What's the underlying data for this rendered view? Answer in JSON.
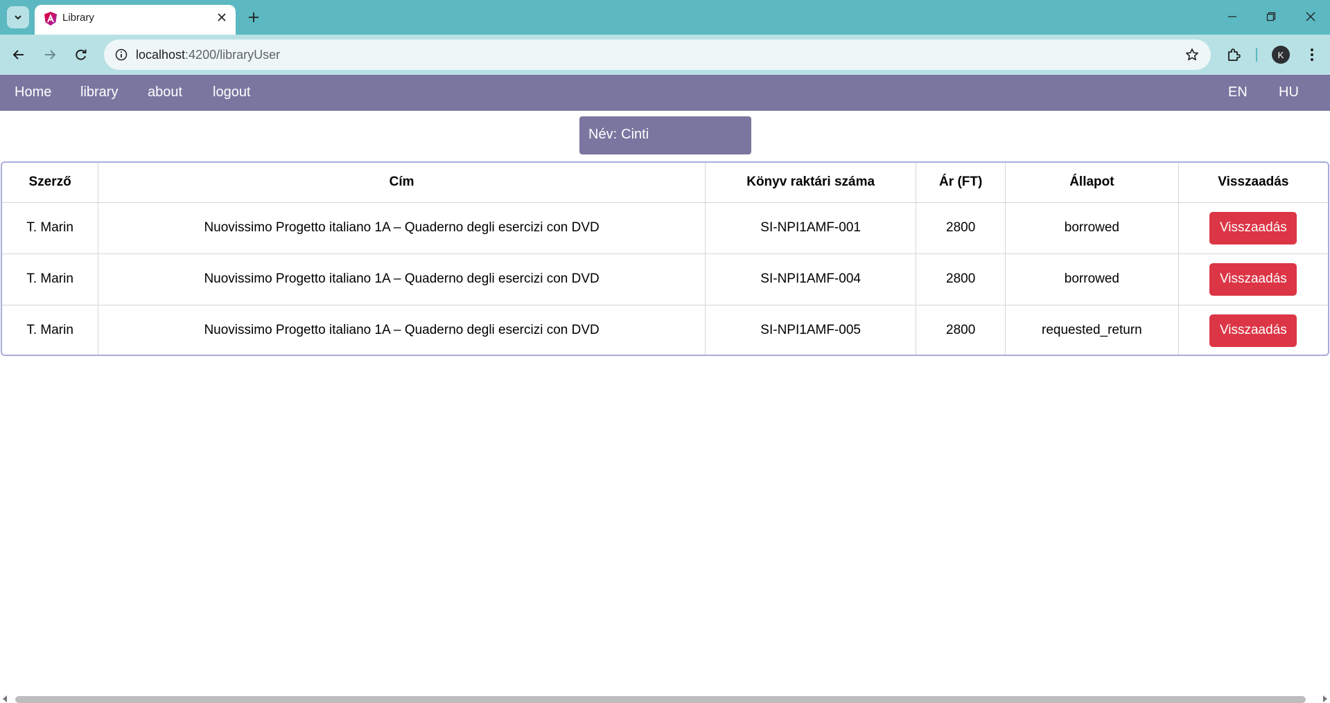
{
  "browser": {
    "tab_title": "Library",
    "url_host": "localhost",
    "url_path": ":4200/libraryUser",
    "profile_initial": "K",
    "icons": [
      "tab-search-icon",
      "angular-favicon-icon",
      "close-icon",
      "plus-icon",
      "minimize-icon",
      "restore-icon",
      "close-window-icon",
      "back-icon",
      "forward-icon",
      "reload-icon",
      "site-info-icon",
      "star-icon",
      "extensions-icon",
      "kebab-menu-icon"
    ]
  },
  "nav": {
    "home": "Home",
    "library": "library",
    "about": "about",
    "logout": "logout",
    "lang_en": "EN",
    "lang_hu": "HU"
  },
  "user": {
    "name_label": "Név:",
    "name_value": "Cinti"
  },
  "table": {
    "headers": [
      "Szerző",
      "Cím",
      "Könyv raktári száma",
      "Ár (FT)",
      "Állapot",
      "Visszaadás"
    ],
    "rows": [
      {
        "author": "T. Marin",
        "title": "Nuovissimo Progetto italiano 1A – Quaderno degli esercizi con DVD",
        "stock_id": "SI-NPI1AMF-001",
        "price": "2800",
        "status": "borrowed",
        "action": "Visszaadás"
      },
      {
        "author": "T. Marin",
        "title": "Nuovissimo Progetto italiano 1A – Quaderno degli esercizi con DVD",
        "stock_id": "SI-NPI1AMF-004",
        "price": "2800",
        "status": "borrowed",
        "action": "Visszaadás"
      },
      {
        "author": "T. Marin",
        "title": "Nuovissimo Progetto italiano 1A – Quaderno degli esercizi con DVD",
        "stock_id": "SI-NPI1AMF-005",
        "price": "2800",
        "status": "requested_return",
        "action": "Visszaadás"
      }
    ]
  },
  "colors": {
    "browser_frame": "#5cb8c1",
    "toolbar": "#b8e1e5",
    "nav_bg": "#7a76a0",
    "return_button": "#dc3545",
    "table_border": "#a9acd9"
  }
}
